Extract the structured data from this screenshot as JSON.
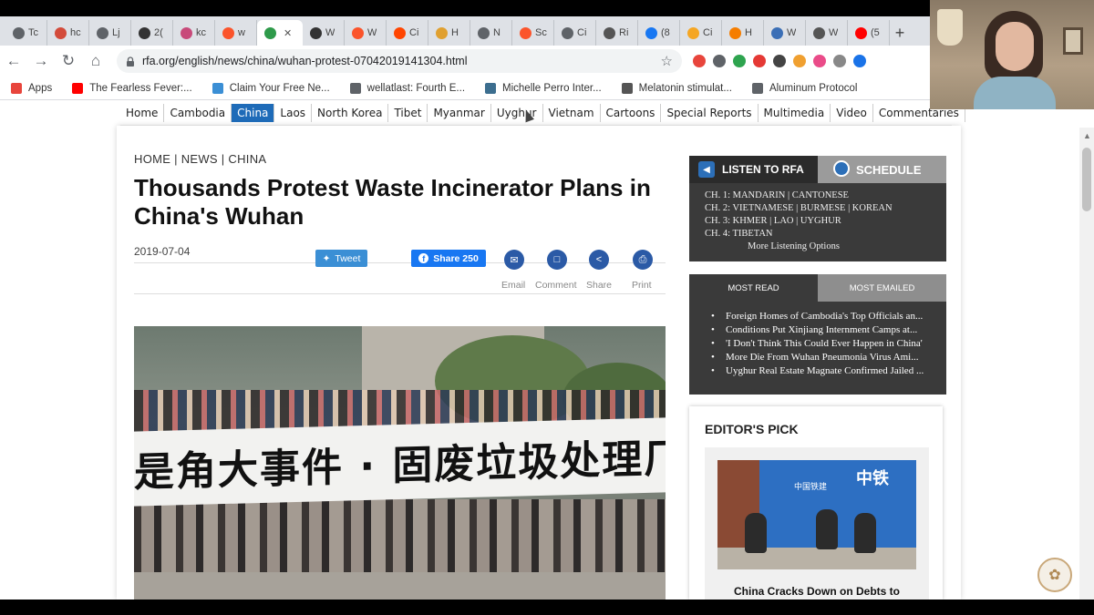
{
  "browser": {
    "tabs": [
      {
        "label": "Tc",
        "icon": "globe-icon",
        "color": "#5f6368"
      },
      {
        "label": "hc",
        "icon": "site-icon",
        "color": "#d34b3a"
      },
      {
        "label": "Lj",
        "icon": "globe-icon",
        "color": "#5f6368"
      },
      {
        "label": "2(",
        "icon": "crosshair-icon",
        "color": "#333333"
      },
      {
        "label": "kc",
        "icon": "site-icon",
        "color": "#c84a7a"
      },
      {
        "label": "w",
        "icon": "brave-icon",
        "color": "#fb542b"
      },
      {
        "label": "",
        "icon": "rfa-icon",
        "color": "#2e9a4a",
        "active": true
      },
      {
        "label": "W",
        "icon": "site-icon",
        "color": "#333333"
      },
      {
        "label": "W",
        "icon": "brave-icon",
        "color": "#fb542b"
      },
      {
        "label": "Ci",
        "icon": "reddit-icon",
        "color": "#ff4500"
      },
      {
        "label": "H",
        "icon": "site-icon",
        "color": "#e0a030"
      },
      {
        "label": "N",
        "icon": "globe-icon",
        "color": "#5f6368"
      },
      {
        "label": "Sc",
        "icon": "brave-icon",
        "color": "#fb542b"
      },
      {
        "label": "Ci",
        "icon": "globe-icon",
        "color": "#5f6368"
      },
      {
        "label": "Ri",
        "icon": "site-icon",
        "color": "#555555"
      },
      {
        "label": "(8",
        "icon": "facebook-icon",
        "color": "#1877f2"
      },
      {
        "label": "Ci",
        "icon": "site-icon",
        "color": "#f5a623"
      },
      {
        "label": "H",
        "icon": "blogger-icon",
        "color": "#f57d00"
      },
      {
        "label": "W",
        "icon": "site-icon",
        "color": "#3b6fb6"
      },
      {
        "label": "W",
        "icon": "site-icon",
        "color": "#555555"
      },
      {
        "label": "(5",
        "icon": "youtube-icon",
        "color": "#ff0000"
      }
    ],
    "new_tab": "+",
    "url": "rfa.org/english/news/china/wuhan-protest-07042019141304.html",
    "bookmarks": [
      {
        "label": "Apps",
        "icon": "apps-grid-icon",
        "color": "#e8453c"
      },
      {
        "label": "The Fearless Fever:...",
        "icon": "youtube-icon",
        "color": "#ff0000"
      },
      {
        "label": "Claim Your Free Ne...",
        "icon": "butterfly-icon",
        "color": "#3b8fd5"
      },
      {
        "label": "wellatlast: Fourth E...",
        "icon": "globe-icon",
        "color": "#5f6368"
      },
      {
        "label": "Michelle Perro Inter...",
        "icon": "site-icon",
        "color": "#3c6e8f"
      },
      {
        "label": "Melatonin stimulat...",
        "icon": "dna-icon",
        "color": "#555555"
      },
      {
        "label": "Aluminum Protocol",
        "icon": "globe-icon",
        "color": "#5f6368"
      }
    ],
    "extensions": [
      "#e8453c",
      "#5f6368",
      "#2ea44f",
      "#e53935",
      "#444444",
      "#f0a030",
      "#ea4c89",
      "#888888",
      "#1a73e8"
    ]
  },
  "site": {
    "nav": [
      "Home",
      "Cambodia",
      "China",
      "Laos",
      "North Korea",
      "Tibet",
      "Myanmar",
      "Uyghur",
      "Vietnam",
      "Cartoons",
      "Special Reports",
      "Multimedia",
      "Video",
      "Commentaries"
    ],
    "nav_selected": "China",
    "accent": "#1e6bb8"
  },
  "article": {
    "breadcrumb": "HOME | NEWS | CHINA",
    "title": "Thousands Protest Waste Incinerator Plans in China's Wuhan",
    "date": "2019-07-04",
    "tweet_label": "Tweet",
    "share_label": "Share 250",
    "actions": [
      "Email",
      "Comment",
      "Share",
      "Print"
    ],
    "photo_banner_text": "是角大事件 · 固废垃圾处理厂建在家门口"
  },
  "sidebar": {
    "listen_title": "LISTEN TO RFA",
    "schedule_title": "SCHEDULE",
    "channels": [
      "CH. 1: MANDARIN | CANTONESE",
      "CH. 2: VIETNAMESE | BURMESE | KOREAN",
      "CH. 3: KHMER | LAO | UYGHUR",
      "CH. 4: TIBETAN"
    ],
    "more_listening": "More Listening Options",
    "most_read_tab": "MOST READ",
    "most_emailed_tab": "MOST EMAILED",
    "most_read": [
      "Foreign Homes of Cambodia's Top Officials an...",
      "Conditions Put Xinjiang Internment Camps at...",
      "'I Don't Think This Could Ever Happen in China'",
      "More Die From Wuhan Pneumonia Virus Ami...",
      "Uyghur Real Estate Magnate Confirmed Jailed ..."
    ],
    "editors_pick_title": "EDITOR'S PICK",
    "pick_sign": "中铁",
    "pick_sign_sub": "中国铁建",
    "pick_caption": "China Cracks Down on Debts to Workers And Private Firms"
  }
}
